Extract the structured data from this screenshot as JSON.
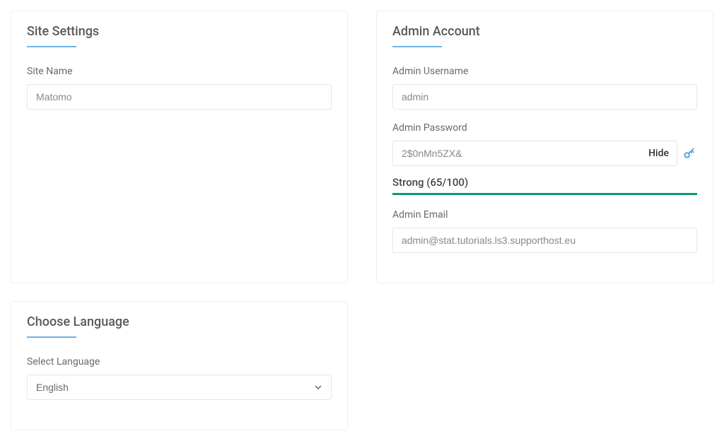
{
  "siteSettings": {
    "title": "Site Settings",
    "siteNameLabel": "Site Name",
    "siteNameValue": "Matomo"
  },
  "adminAccount": {
    "title": "Admin Account",
    "usernameLabel": "Admin Username",
    "usernameValue": "admin",
    "passwordLabel": "Admin Password",
    "passwordValue": "2$0nMn5ZX&",
    "hideLabel": "Hide",
    "strengthLabel": "Strong (65/100)",
    "strengthColor": "#0d9776",
    "emailLabel": "Admin Email",
    "emailValue": "admin@stat.tutorials.ls3.supporthost.eu"
  },
  "language": {
    "title": "Choose Language",
    "selectLabel": "Select Language",
    "selectedValue": "English"
  }
}
